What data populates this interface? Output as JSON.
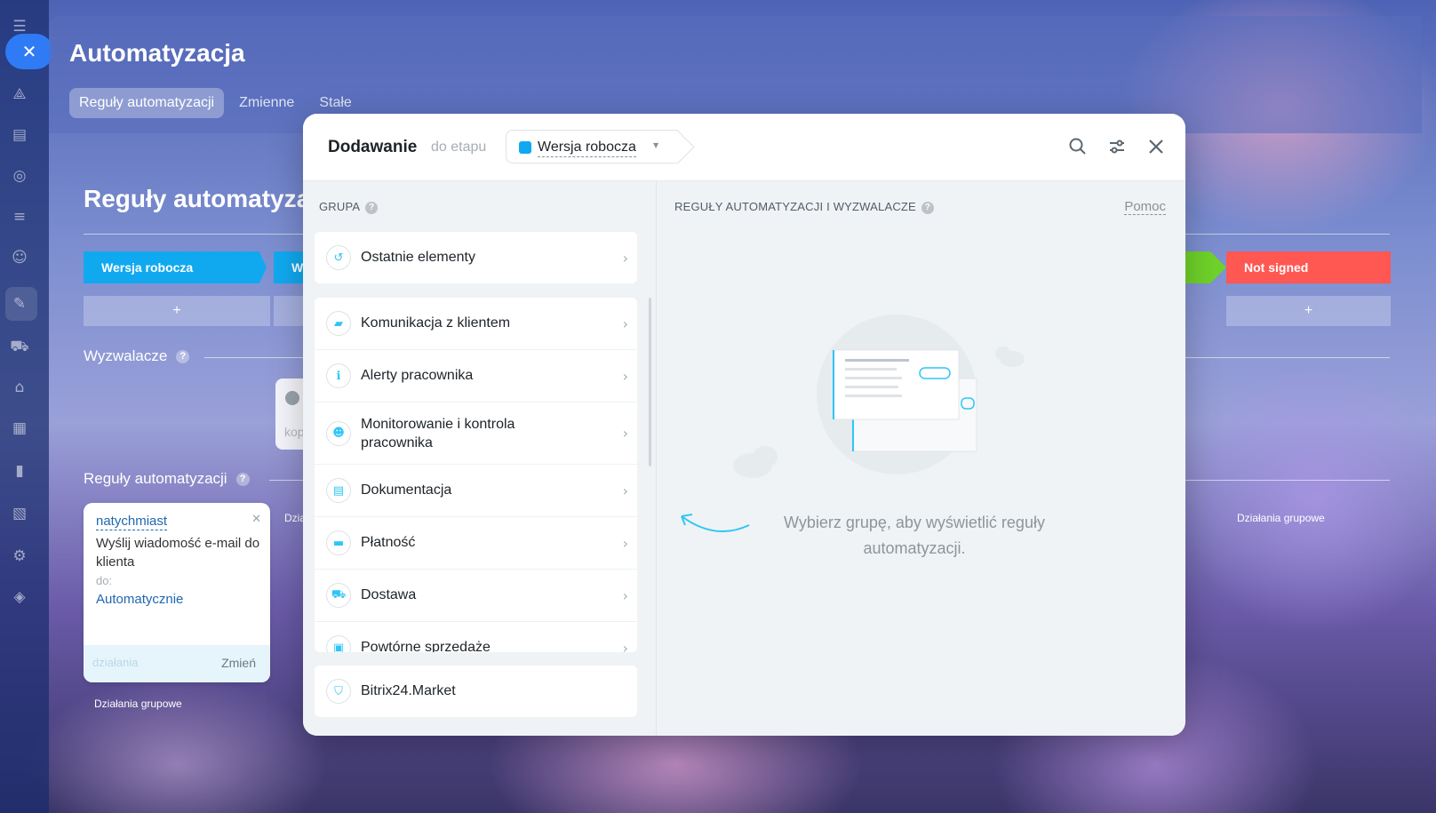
{
  "app": {
    "title": "Automatyzacja",
    "tabs": [
      {
        "label": "Reguły automatyzacji",
        "active": true
      },
      {
        "label": "Zmienne",
        "active": false
      },
      {
        "label": "Stałe",
        "active": false
      }
    ]
  },
  "page": {
    "title": "Reguły automatyza",
    "stages": {
      "draft": "Wersja robocza",
      "second": "W",
      "not_signed": "Not signed"
    },
    "add_label": "+",
    "triggers_label": "Wyzwalacze",
    "trigger_stub_text": "kop",
    "rules_label": "Reguły automatyzacji",
    "rule_card": {
      "when": "natychmiast",
      "description": "Wyślij wiadomość e-mail do klienta",
      "to_label": "do:",
      "recipient": "Automatycznie",
      "actions_label": "działania",
      "change_label": "Zmień"
    },
    "group_actions_label": "Działania grupowe",
    "group_actions_stub": "Dzia"
  },
  "modal": {
    "title": "Dodawanie",
    "subtitle": "do etapu",
    "stage_selector": "Wersja robocza",
    "group_header": "GRUPA",
    "rules_header": "REGUŁY AUTOMATYZACJI I WYZWALACZE",
    "help": "Pomoc",
    "recent": "Ostatnie elementy",
    "groups": [
      {
        "label": "Komunikacja z klientem",
        "icon": "chat-icon"
      },
      {
        "label": "Alerty pracownika",
        "icon": "info-icon"
      },
      {
        "label": "Monitorowanie i kontrola pracownika",
        "icon": "people-icon"
      },
      {
        "label": "Dokumentacja",
        "icon": "document-icon"
      },
      {
        "label": "Płatność",
        "icon": "wallet-icon"
      },
      {
        "label": "Dostawa",
        "icon": "truck-icon"
      },
      {
        "label": "Powtórne sprzedaże",
        "icon": "bag-icon"
      }
    ],
    "market": "Bitrix24.Market",
    "empty_state": "Wybierz grupę, aby wyświetlić reguły automatyzacji."
  },
  "colors": {
    "stage_draft": "#10a9f0",
    "stage_not_signed": "#ff5752",
    "stage_green": "#6fd22a",
    "accent": "#2fc6f6",
    "close_button": "#2f7bf6"
  }
}
